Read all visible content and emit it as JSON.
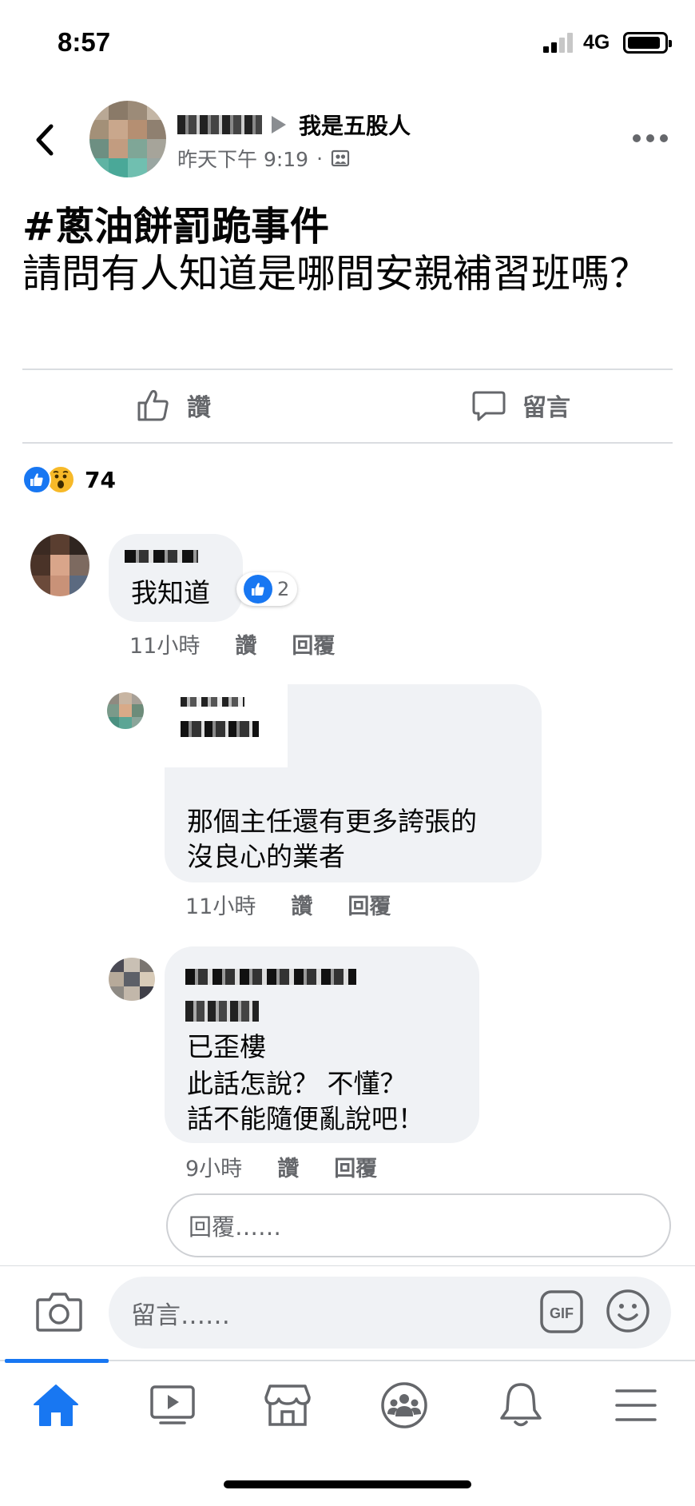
{
  "status_bar": {
    "time": "8:57",
    "network": "4G",
    "battery_level": 0.9
  },
  "post": {
    "group_name": "我是五股人",
    "timestamp": "昨天下午 9:19",
    "meta_separator": "·",
    "privacy_icon": "group-icon",
    "hashtag": "#蔥油餅罰跪事件",
    "body": "請問有人知道是哪間安親補習班嗎？",
    "actions": {
      "like_label": "讚",
      "comment_label": "留言"
    },
    "reactions": {
      "icons": [
        "like-icon",
        "wow-icon"
      ],
      "count": "74"
    }
  },
  "comments": [
    {
      "text": "我知道",
      "like_count": "2",
      "time": "11小時",
      "like_label": "讚",
      "reply_label": "回覆"
    },
    {
      "lines": [
        "那個主任還有更多誇張的",
        "沒良心的業者"
      ],
      "time": "11小時",
      "like_label": "讚",
      "reply_label": "回覆"
    },
    {
      "lines": [
        "已歪樓",
        "此話怎說？ 不懂？",
        "話不能隨便亂說吧！"
      ],
      "time": "9小時",
      "like_label": "讚",
      "reply_label": "回覆"
    }
  ],
  "reply_placeholder": "回覆……",
  "compose": {
    "placeholder": "留言……",
    "gif_label": "GIF"
  },
  "colors": {
    "accent": "#1877f2",
    "secondary_text": "#65676b",
    "bubble": "#f0f2f5"
  },
  "tab_bar": {
    "tabs": [
      "home-icon",
      "watch-icon",
      "marketplace-icon",
      "groups-icon",
      "notifications-icon",
      "menu-icon"
    ],
    "active": "home-icon"
  }
}
